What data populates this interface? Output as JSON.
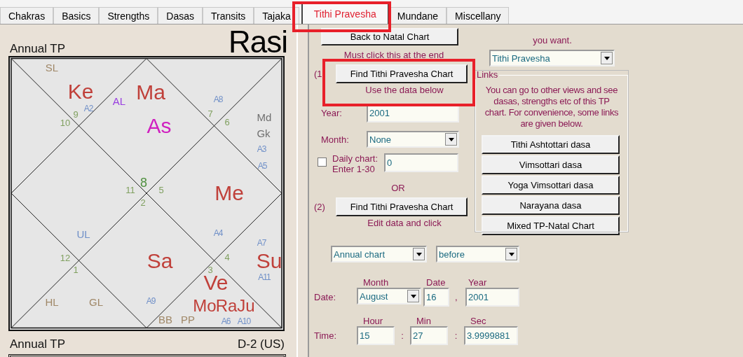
{
  "tabs": [
    {
      "label": "Chakras",
      "selected": false
    },
    {
      "label": "Basics",
      "selected": false
    },
    {
      "label": "Strengths",
      "selected": false
    },
    {
      "label": "Dasas",
      "selected": false
    },
    {
      "label": "Transits",
      "selected": false
    },
    {
      "label": "Tajaka",
      "selected": false
    },
    {
      "label": "Tithi Pravesha",
      "selected": true
    },
    {
      "label": "Mundane",
      "selected": false
    },
    {
      "label": "Miscellany",
      "selected": false
    }
  ],
  "chart": {
    "title": "Annual TP",
    "name": "Rasi",
    "labels": [
      {
        "text": "SL",
        "kind": "tag",
        "color": "#a08868"
      },
      {
        "text": "Ke",
        "kind": "planet",
        "color": "#c0403a"
      },
      {
        "text": "A2",
        "kind": "arudha",
        "color": "#7090c8"
      },
      {
        "text": "AL",
        "kind": "tag",
        "color": "#9a40e0"
      },
      {
        "text": "Ma",
        "kind": "planet",
        "color": "#c0403a"
      },
      {
        "text": "A8",
        "kind": "arudha",
        "color": "#7090c8"
      },
      {
        "text": "9",
        "kind": "sign",
        "color": "#80a060"
      },
      {
        "text": "7",
        "kind": "sign",
        "color": "#80a060"
      },
      {
        "text": "10",
        "kind": "sign",
        "color": "#80a060"
      },
      {
        "text": "As",
        "kind": "planet",
        "color": "#d020c0"
      },
      {
        "text": "6",
        "kind": "sign",
        "color": "#80a060"
      },
      {
        "text": "Md",
        "kind": "tag",
        "color": "#707070"
      },
      {
        "text": "Gk",
        "kind": "tag",
        "color": "#707070"
      },
      {
        "text": "A3",
        "kind": "arudha",
        "color": "#7090c8"
      },
      {
        "text": "A5",
        "kind": "arudha",
        "color": "#7090c8"
      },
      {
        "text": "11",
        "kind": "sign",
        "color": "#80a060"
      },
      {
        "text": "8",
        "kind": "rising-sign",
        "color": "#509040"
      },
      {
        "text": "5",
        "kind": "sign",
        "color": "#80a060"
      },
      {
        "text": "Me",
        "kind": "planet",
        "color": "#c0403a"
      },
      {
        "text": "2",
        "kind": "sign",
        "color": "#80a060"
      },
      {
        "text": "UL",
        "kind": "tag",
        "color": "#7090c8"
      },
      {
        "text": "A4",
        "kind": "arudha",
        "color": "#7090c8"
      },
      {
        "text": "A7",
        "kind": "arudha",
        "color": "#7090c8"
      },
      {
        "text": "12",
        "kind": "sign",
        "color": "#80a060"
      },
      {
        "text": "Sa",
        "kind": "planet",
        "color": "#c0403a"
      },
      {
        "text": "4",
        "kind": "sign",
        "color": "#80a060"
      },
      {
        "text": "Su",
        "kind": "planet",
        "color": "#c0403a"
      },
      {
        "text": "1",
        "kind": "sign",
        "color": "#80a060"
      },
      {
        "text": "3",
        "kind": "sign",
        "color": "#80a060"
      },
      {
        "text": "A11",
        "kind": "arudha",
        "color": "#7090c8"
      },
      {
        "text": "Ve",
        "kind": "planet",
        "color": "#c0403a"
      },
      {
        "text": "HL",
        "kind": "tag",
        "color": "#a08868"
      },
      {
        "text": "GL",
        "kind": "tag",
        "color": "#a08868"
      },
      {
        "text": "A9",
        "kind": "arudha",
        "color": "#7090c8"
      },
      {
        "text": "Mo",
        "kind": "planet-small",
        "color": "#c0403a"
      },
      {
        "text": "Ra",
        "kind": "planet-small",
        "color": "#c0403a"
      },
      {
        "text": "Ju",
        "kind": "planet-small",
        "color": "#c0403a"
      },
      {
        "text": "BB",
        "kind": "tag",
        "color": "#a08868"
      },
      {
        "text": "PP",
        "kind": "tag",
        "color": "#a08868"
      },
      {
        "text": "A6",
        "kind": "arudha",
        "color": "#7090c8"
      },
      {
        "text": "A10",
        "kind": "arudha",
        "color": "#7090c8"
      }
    ]
  },
  "chart2": {
    "title": "Annual TP",
    "name": "D-2 (US)"
  },
  "form": {
    "back_button": "Back to Natal Chart",
    "back_note": "Must click this at the end",
    "step1": {
      "marker": "(1",
      "button": "Find Tithi Pravesha Chart",
      "note": "Use the data below"
    },
    "year": {
      "label": "Year:",
      "value": "2001"
    },
    "month": {
      "label": "Month:",
      "value": "None"
    },
    "daily": {
      "label": "Daily chart: Enter 1-30",
      "checked": false,
      "value": "0"
    },
    "or": "OR",
    "step2": {
      "marker": "(2)",
      "button": "Find Tithi Pravesha Chart",
      "note": "Edit data and click"
    },
    "chart_select": {
      "hint": "you want.",
      "value": "Tithi Pravesha"
    },
    "links": {
      "title": "Links",
      "text": "You can go to other views and see dasas, strengths etc of this TP chart. For convenience, some links are given below.",
      "buttons": [
        "Tithi Ashtottari dasa",
        "Vimsottari dasa",
        "Yoga Vimsottari dasa",
        "Narayana dasa",
        "Mixed TP-Natal Chart"
      ]
    },
    "period": "Annual chart",
    "direction": "before",
    "date": {
      "label": "Date:",
      "month_label": "Month",
      "month": "August",
      "day_label": "Date",
      "day": "16",
      "separator": ",",
      "year_label": "Year",
      "year": "2001"
    },
    "time": {
      "label": "Time:",
      "hour_label": "Hour",
      "hour": "15",
      "min_label": "Min",
      "min": "27",
      "sec_label": "Sec",
      "sec": "3.9999881",
      "separator": ":"
    }
  }
}
